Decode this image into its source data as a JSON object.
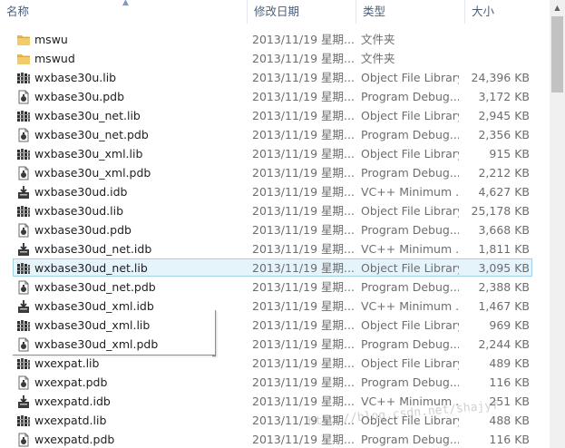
{
  "columns": {
    "name": "名称",
    "date": "修改日期",
    "type": "类型",
    "size": "大小"
  },
  "sort": {
    "column": "name",
    "icon": "sort-ascending-arrow-icon"
  },
  "colors": {
    "selection_fill": "#e5f3fb",
    "selection_border": "#9fd0ec",
    "folder": "#e8b64c",
    "header_text": "#4c607a",
    "detail_text": "#6d6d6d"
  },
  "rows": [
    {
      "name": "mswu",
      "date": "2013/11/19 星期...",
      "type": "文件夹",
      "size": "",
      "icon": "folder-icon"
    },
    {
      "name": "mswud",
      "date": "2013/11/19 星期...",
      "type": "文件夹",
      "size": "",
      "icon": "folder-icon"
    },
    {
      "name": "wxbase30u.lib",
      "date": "2013/11/19 星期...",
      "type": "Object File Library",
      "size": "24,396 KB",
      "icon": "library-file-icon"
    },
    {
      "name": "wxbase30u.pdb",
      "date": "2013/11/19 星期...",
      "type": "Program Debug...",
      "size": "3,172 KB",
      "icon": "debug-file-icon"
    },
    {
      "name": "wxbase30u_net.lib",
      "date": "2013/11/19 星期...",
      "type": "Object File Library",
      "size": "2,945 KB",
      "icon": "library-file-icon"
    },
    {
      "name": "wxbase30u_net.pdb",
      "date": "2013/11/19 星期...",
      "type": "Program Debug...",
      "size": "2,356 KB",
      "icon": "debug-file-icon"
    },
    {
      "name": "wxbase30u_xml.lib",
      "date": "2013/11/19 星期...",
      "type": "Object File Library",
      "size": "915 KB",
      "icon": "library-file-icon"
    },
    {
      "name": "wxbase30u_xml.pdb",
      "date": "2013/11/19 星期...",
      "type": "Program Debug...",
      "size": "2,212 KB",
      "icon": "debug-file-icon"
    },
    {
      "name": "wxbase30ud.idb",
      "date": "2013/11/19 星期...",
      "type": "VC++ Minimum ...",
      "size": "4,627 KB",
      "icon": "vc-idb-file-icon"
    },
    {
      "name": "wxbase30ud.lib",
      "date": "2013/11/19 星期...",
      "type": "Object File Library",
      "size": "25,178 KB",
      "icon": "library-file-icon"
    },
    {
      "name": "wxbase30ud.pdb",
      "date": "2013/11/19 星期...",
      "type": "Program Debug...",
      "size": "3,668 KB",
      "icon": "debug-file-icon"
    },
    {
      "name": "wxbase30ud_net.idb",
      "date": "2013/11/19 星期...",
      "type": "VC++ Minimum ...",
      "size": "1,811 KB",
      "icon": "vc-idb-file-icon"
    },
    {
      "name": "wxbase30ud_net.lib",
      "date": "2013/11/19 星期...",
      "type": "Object File Library",
      "size": "3,095 KB",
      "icon": "library-file-icon",
      "selected": true
    },
    {
      "name": "wxbase30ud_net.pdb",
      "date": "2013/11/19 星期...",
      "type": "Program Debug...",
      "size": "2,388 KB",
      "icon": "debug-file-icon"
    },
    {
      "name": "wxbase30ud_xml.idb",
      "date": "2013/11/19 星期...",
      "type": "VC++ Minimum ...",
      "size": "1,467 KB",
      "icon": "vc-idb-file-icon"
    },
    {
      "name": "wxbase30ud_xml.lib",
      "date": "2013/11/19 星期...",
      "type": "Object File Library",
      "size": "969 KB",
      "icon": "library-file-icon"
    },
    {
      "name": "wxbase30ud_xml.pdb",
      "date": "2013/11/19 星期...",
      "type": "Program Debug...",
      "size": "2,244 KB",
      "icon": "debug-file-icon"
    },
    {
      "name": "wxexpat.lib",
      "date": "2013/11/19 星期...",
      "type": "Object File Library",
      "size": "489 KB",
      "icon": "library-file-icon"
    },
    {
      "name": "wxexpat.pdb",
      "date": "2013/11/19 星期...",
      "type": "Program Debug...",
      "size": "116 KB",
      "icon": "debug-file-icon"
    },
    {
      "name": "wxexpatd.idb",
      "date": "2013/11/19 星期...",
      "type": "VC++ Minimum ...",
      "size": "251 KB",
      "icon": "vc-idb-file-icon"
    },
    {
      "name": "wxexpatd.lib",
      "date": "2013/11/19 星期...",
      "type": "Object File Library",
      "size": "488 KB",
      "icon": "library-file-icon"
    },
    {
      "name": "wxexpatd.pdb",
      "date": "2013/11/19 星期...",
      "type": "Program Debug...",
      "size": "116 KB",
      "icon": "debug-file-icon"
    }
  ],
  "watermark": "http://blog.csdn.net/shajyf"
}
